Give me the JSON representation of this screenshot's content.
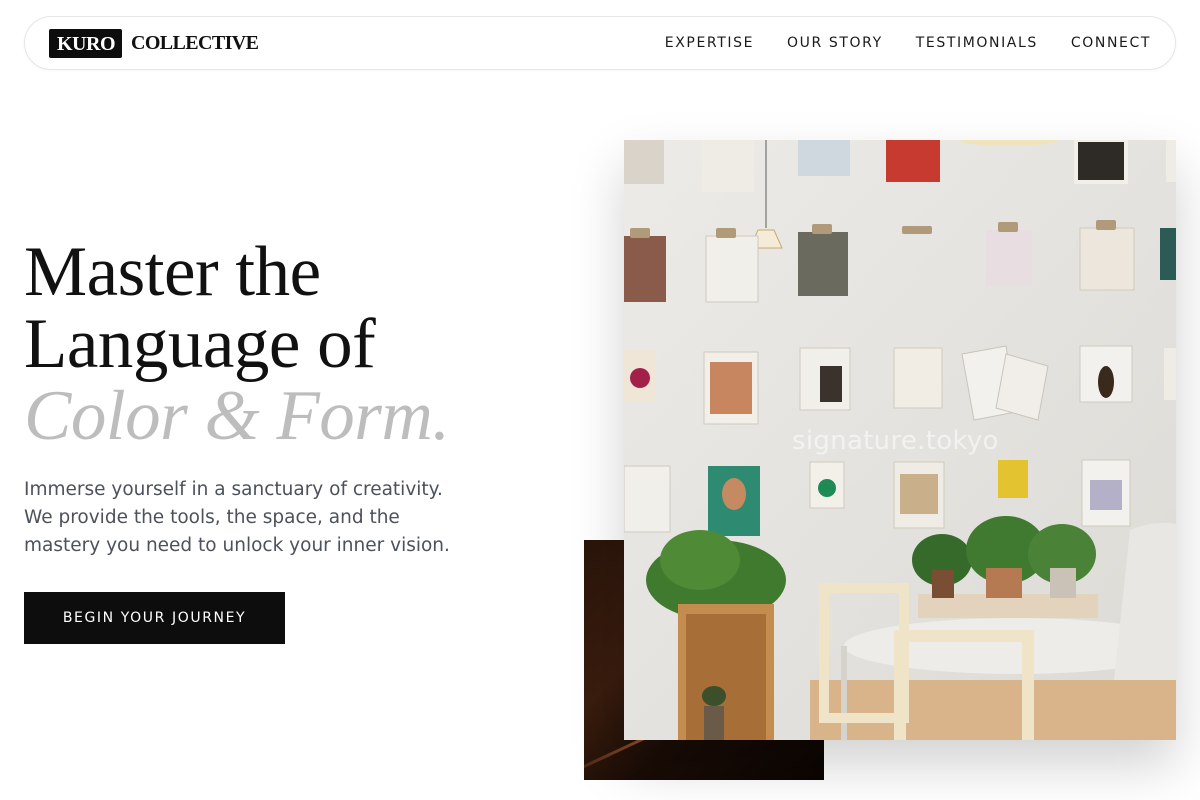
{
  "brand": {
    "mark": "KURO",
    "name": "COLLECTIVE"
  },
  "nav": {
    "items": [
      {
        "label": "EXPERTISE"
      },
      {
        "label": "OUR STORY"
      },
      {
        "label": "TESTIMONIALS"
      },
      {
        "label": "CONNECT"
      }
    ]
  },
  "hero": {
    "headline_line1": "Master the",
    "headline_line2": "Language of",
    "headline_accent": "Color & Form.",
    "subcopy": "Immerse yourself in a sanctuary of creativity. We provide the tools, the space, and the mastery you need to unlock your inner vision.",
    "cta_label": "BEGIN YOUR JOURNEY"
  },
  "images": {
    "main_watermark": "signature.tokyo"
  },
  "colors": {
    "ink": "#0d0d0d",
    "accent_text": "#bdbdbd",
    "body_text": "#4c515b",
    "wall": "#e4e2de"
  }
}
